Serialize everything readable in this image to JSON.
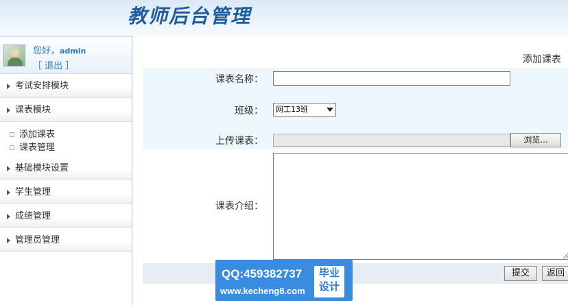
{
  "header": {
    "title": "教师后台管理"
  },
  "user": {
    "greeting": "您好，",
    "name": "admin",
    "logout": "［ 退出 ］"
  },
  "sidebar": {
    "items": [
      {
        "label": "考试安排模块"
      },
      {
        "label": "课表模块"
      },
      {
        "label": "基础模块设置"
      },
      {
        "label": "学生管理"
      },
      {
        "label": "成绩管理"
      },
      {
        "label": "管理员管理"
      }
    ],
    "subitems": [
      {
        "label": "添加课表"
      },
      {
        "label": "课表管理"
      }
    ]
  },
  "form": {
    "page_title": "添加课表",
    "name_label": "课表名称：",
    "name_value": "",
    "class_label": "班级：",
    "class_value": "网工13班",
    "upload_label": "上传课表：",
    "browse_label": "浏览...",
    "intro_label": "课表介绍：",
    "intro_value": "",
    "submit_label": "提交",
    "back_label": "返回"
  },
  "watermark": {
    "qq": "QQ:459382737",
    "url": "www.kecheng8.com",
    "badge_line1": "毕业",
    "badge_line2": "设计"
  },
  "colors": {
    "accent": "#2a7ab8",
    "title": "#1f5d9e",
    "row_highlight": "#eef7fc",
    "watermark": "#3a8ce0"
  }
}
